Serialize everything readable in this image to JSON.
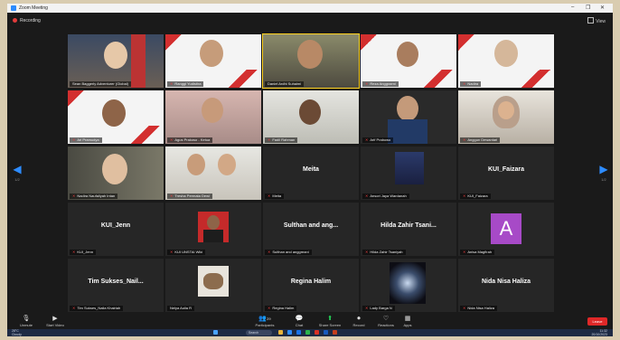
{
  "window": {
    "title": "Zoom Meeting",
    "controls": [
      "–",
      "❐",
      "✕"
    ]
  },
  "status": {
    "recording_label": "Recording",
    "view_label": "View"
  },
  "nav": {
    "left_arrow": "◀",
    "right_arrow": "▶",
    "left_page": "1/2",
    "right_page": "1/2"
  },
  "participants": [
    {
      "name": "Sean Baggerly Adventurer (Global)",
      "tile_text": "",
      "muted": false,
      "kind": "video"
    },
    {
      "name": "Ranggi Yudistira",
      "tile_text": "",
      "muted": true,
      "kind": "banner"
    },
    {
      "name": "Daniel Ardhi Suhaimi",
      "tile_text": "",
      "muted": false,
      "kind": "video",
      "active": true
    },
    {
      "name": "Reza Anggraeni",
      "tile_text": "",
      "muted": true,
      "kind": "banner"
    },
    {
      "name": "Nadira",
      "tile_text": "",
      "muted": true,
      "kind": "banner"
    },
    {
      "name": "Ari Pramudya",
      "tile_text": "",
      "muted": true,
      "kind": "banner"
    },
    {
      "name": "Agus Prakoso - Ketua",
      "tile_text": "",
      "muted": true,
      "kind": "video"
    },
    {
      "name": "Fadil Rahman",
      "tile_text": "",
      "muted": true,
      "kind": "video"
    },
    {
      "name": "Arif Prabowo",
      "tile_text": "",
      "muted": true,
      "kind": "video"
    },
    {
      "name": "Anggun Dewantari",
      "tile_text": "",
      "muted": true,
      "kind": "video"
    },
    {
      "name": "Nadira Naufaliyah Intan",
      "tile_text": "",
      "muted": true,
      "kind": "video"
    },
    {
      "name": "Tresha Permata Dewi",
      "tile_text": "",
      "muted": true,
      "kind": "video"
    },
    {
      "name": "Meita",
      "tile_text": "Meita",
      "muted": true,
      "kind": "name"
    },
    {
      "name": "Ansori Jaya Wardanah",
      "tile_text": "",
      "muted": true,
      "kind": "video"
    },
    {
      "name": "KUI_Faizara",
      "tile_text": "KUI_Faizara",
      "muted": true,
      "kind": "name"
    },
    {
      "name": "KUI_Jenn",
      "tile_text": "KUI_Jenn",
      "muted": true,
      "kind": "name"
    },
    {
      "name": "KUI UNSTAI Wiki",
      "tile_text": "",
      "muted": true,
      "kind": "video"
    },
    {
      "name": "Sulthan and anggreani",
      "tile_text": "Sulthan and ang...",
      "muted": true,
      "kind": "name"
    },
    {
      "name": "Hilda Zahir Tsaniyah",
      "tile_text": "Hilda Zahir Tsani...",
      "muted": true,
      "kind": "name"
    },
    {
      "name": "Anisa Magfirah",
      "tile_text": "A",
      "muted": true,
      "kind": "avatar"
    },
    {
      "name": "Tim Sukses_Naila Khairiah",
      "tile_text": "Tim Sukses_Nail...",
      "muted": true,
      "kind": "name"
    },
    {
      "name": "Nelya Aulia R",
      "tile_text": "",
      "muted": false,
      "kind": "image"
    },
    {
      "name": "Regina Halim",
      "tile_text": "Regina Halim",
      "muted": true,
      "kind": "name"
    },
    {
      "name": "Lady Barga N",
      "tile_text": "",
      "muted": true,
      "kind": "image"
    },
    {
      "name": "Nida Nisa Haliza",
      "tile_text": "Nida Nisa Haliza",
      "muted": true,
      "kind": "name"
    }
  ],
  "toolbar": {
    "unmute": "Unmute",
    "start_video": "Start Video",
    "participants": "Participants",
    "participants_count": "29",
    "chat": "Chat",
    "share_screen": "Share Screen",
    "record": "Record",
    "reactions": "Reactions",
    "apps": "Apps",
    "leave": "Leave"
  },
  "taskbar": {
    "weather_temp": "28°C",
    "weather_text": "Cloudy",
    "search": "Search",
    "time": "11:32",
    "date": "20/10/2023"
  }
}
